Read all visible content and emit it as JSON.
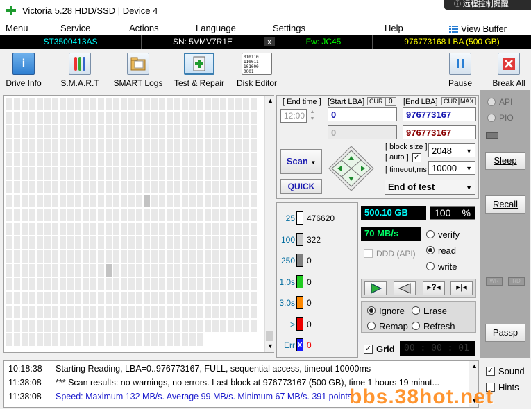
{
  "window": {
    "title": "Victoria 5.28 HDD/SSD | Device 4",
    "overlay_text": "远程控制提醒"
  },
  "menu": [
    "Menu",
    "Service",
    "Actions",
    "Language",
    "Settings",
    "Help"
  ],
  "view_buffer_label": "View Buffer Live",
  "infobar": {
    "model": "ST3500413AS",
    "serial": "SN: 5VMV7R1E",
    "close_symbol": "x",
    "firmware": "Fw: JC45",
    "lba": "976773168 LBA (500 GB)",
    "colors": {
      "model": "#00ffff",
      "serial": "#ffffff",
      "firmware": "#00ff00",
      "lba": "#ffff00"
    }
  },
  "toolbar": {
    "buttons": [
      "Drive Info",
      "S.M.A.R.T",
      "SMART Logs",
      "Test & Repair",
      "Disk Editor"
    ],
    "pause_label": "Pause",
    "break_label": "Break All",
    "disk_editor_glyph": "010110 110011 101000 0001"
  },
  "scan_params": {
    "end_time_label": "[ End time ]",
    "end_time_value": "12:00",
    "start_lba_label": "[Start LBA]",
    "cur_label": "CUR",
    "start_cur_value": "0",
    "end_lba_label": "[End LBA]",
    "max_label": "MAX",
    "start_lba": "0",
    "end_lba": "976773167",
    "start_lba_2": "0",
    "end_lba_2": "976773167",
    "block_size_label": "[ block size ]",
    "auto_label": "[ auto ]",
    "block_size": "2048",
    "timeout_label": "[ timeout,ms ]",
    "timeout": "10000",
    "end_action": "End of test",
    "scan_label": "Scan",
    "quick_label": "QUICK"
  },
  "legend": [
    {
      "label": "25",
      "count": "476620",
      "color": "#ffffff"
    },
    {
      "label": "100",
      "count": "322",
      "color": "#c8c8c8"
    },
    {
      "label": "250",
      "count": "0",
      "color": "#808080"
    },
    {
      "label": "1.0s",
      "count": "0",
      "color": "#22cc22"
    },
    {
      "label": "3.0s",
      "count": "0",
      "color": "#ff8800"
    },
    {
      "label": ">",
      "count": "0",
      "color": "#ee0000"
    },
    {
      "label": "Err",
      "count": "0",
      "color": "#1a1aff"
    }
  ],
  "legend_err_mark": "x",
  "stats": {
    "size": "500.10 GB",
    "percent": "100",
    "percent_sign": "%",
    "speed": "70 MB/s",
    "ddd_label": "DDD (API)",
    "modes": [
      "verify",
      "read",
      "write"
    ],
    "selected_mode": "read",
    "actions": [
      "Ignore",
      "Erase",
      "Remap",
      "Refresh"
    ],
    "selected_action": "Ignore",
    "grid_label": "Grid",
    "timer": "00 : 00 : 01",
    "progress": 1.0
  },
  "sidebar": {
    "api_label": "API",
    "pio_label": "PIO",
    "sleep_label": "Sleep",
    "recall_label": "Recall",
    "wr_label": "WR",
    "rd_label": "RD",
    "passp_label": "Passp"
  },
  "log": [
    {
      "time": "10:18:38",
      "msg": "Starting Reading, LBA=0..976773167, FULL, sequential access, timeout 10000ms",
      "color": "#000000"
    },
    {
      "time": "11:38:08",
      "msg": "*** Scan results: no warnings, no errors. Last block at 976773167 (500 GB), time 1 hours 19 minut...",
      "color": "#000000"
    },
    {
      "time": "11:38:08",
      "msg": "Speed: Maximum 132 MB/s. Average 99 MB/s. Minimum 67 MB/s. 391 points.",
      "color": "#1a1acc"
    }
  ],
  "options": {
    "sound_label": "Sound",
    "hints_label": "Hints",
    "sound_checked": true,
    "hints_checked": false
  },
  "watermark": "bbs.38hot.net"
}
